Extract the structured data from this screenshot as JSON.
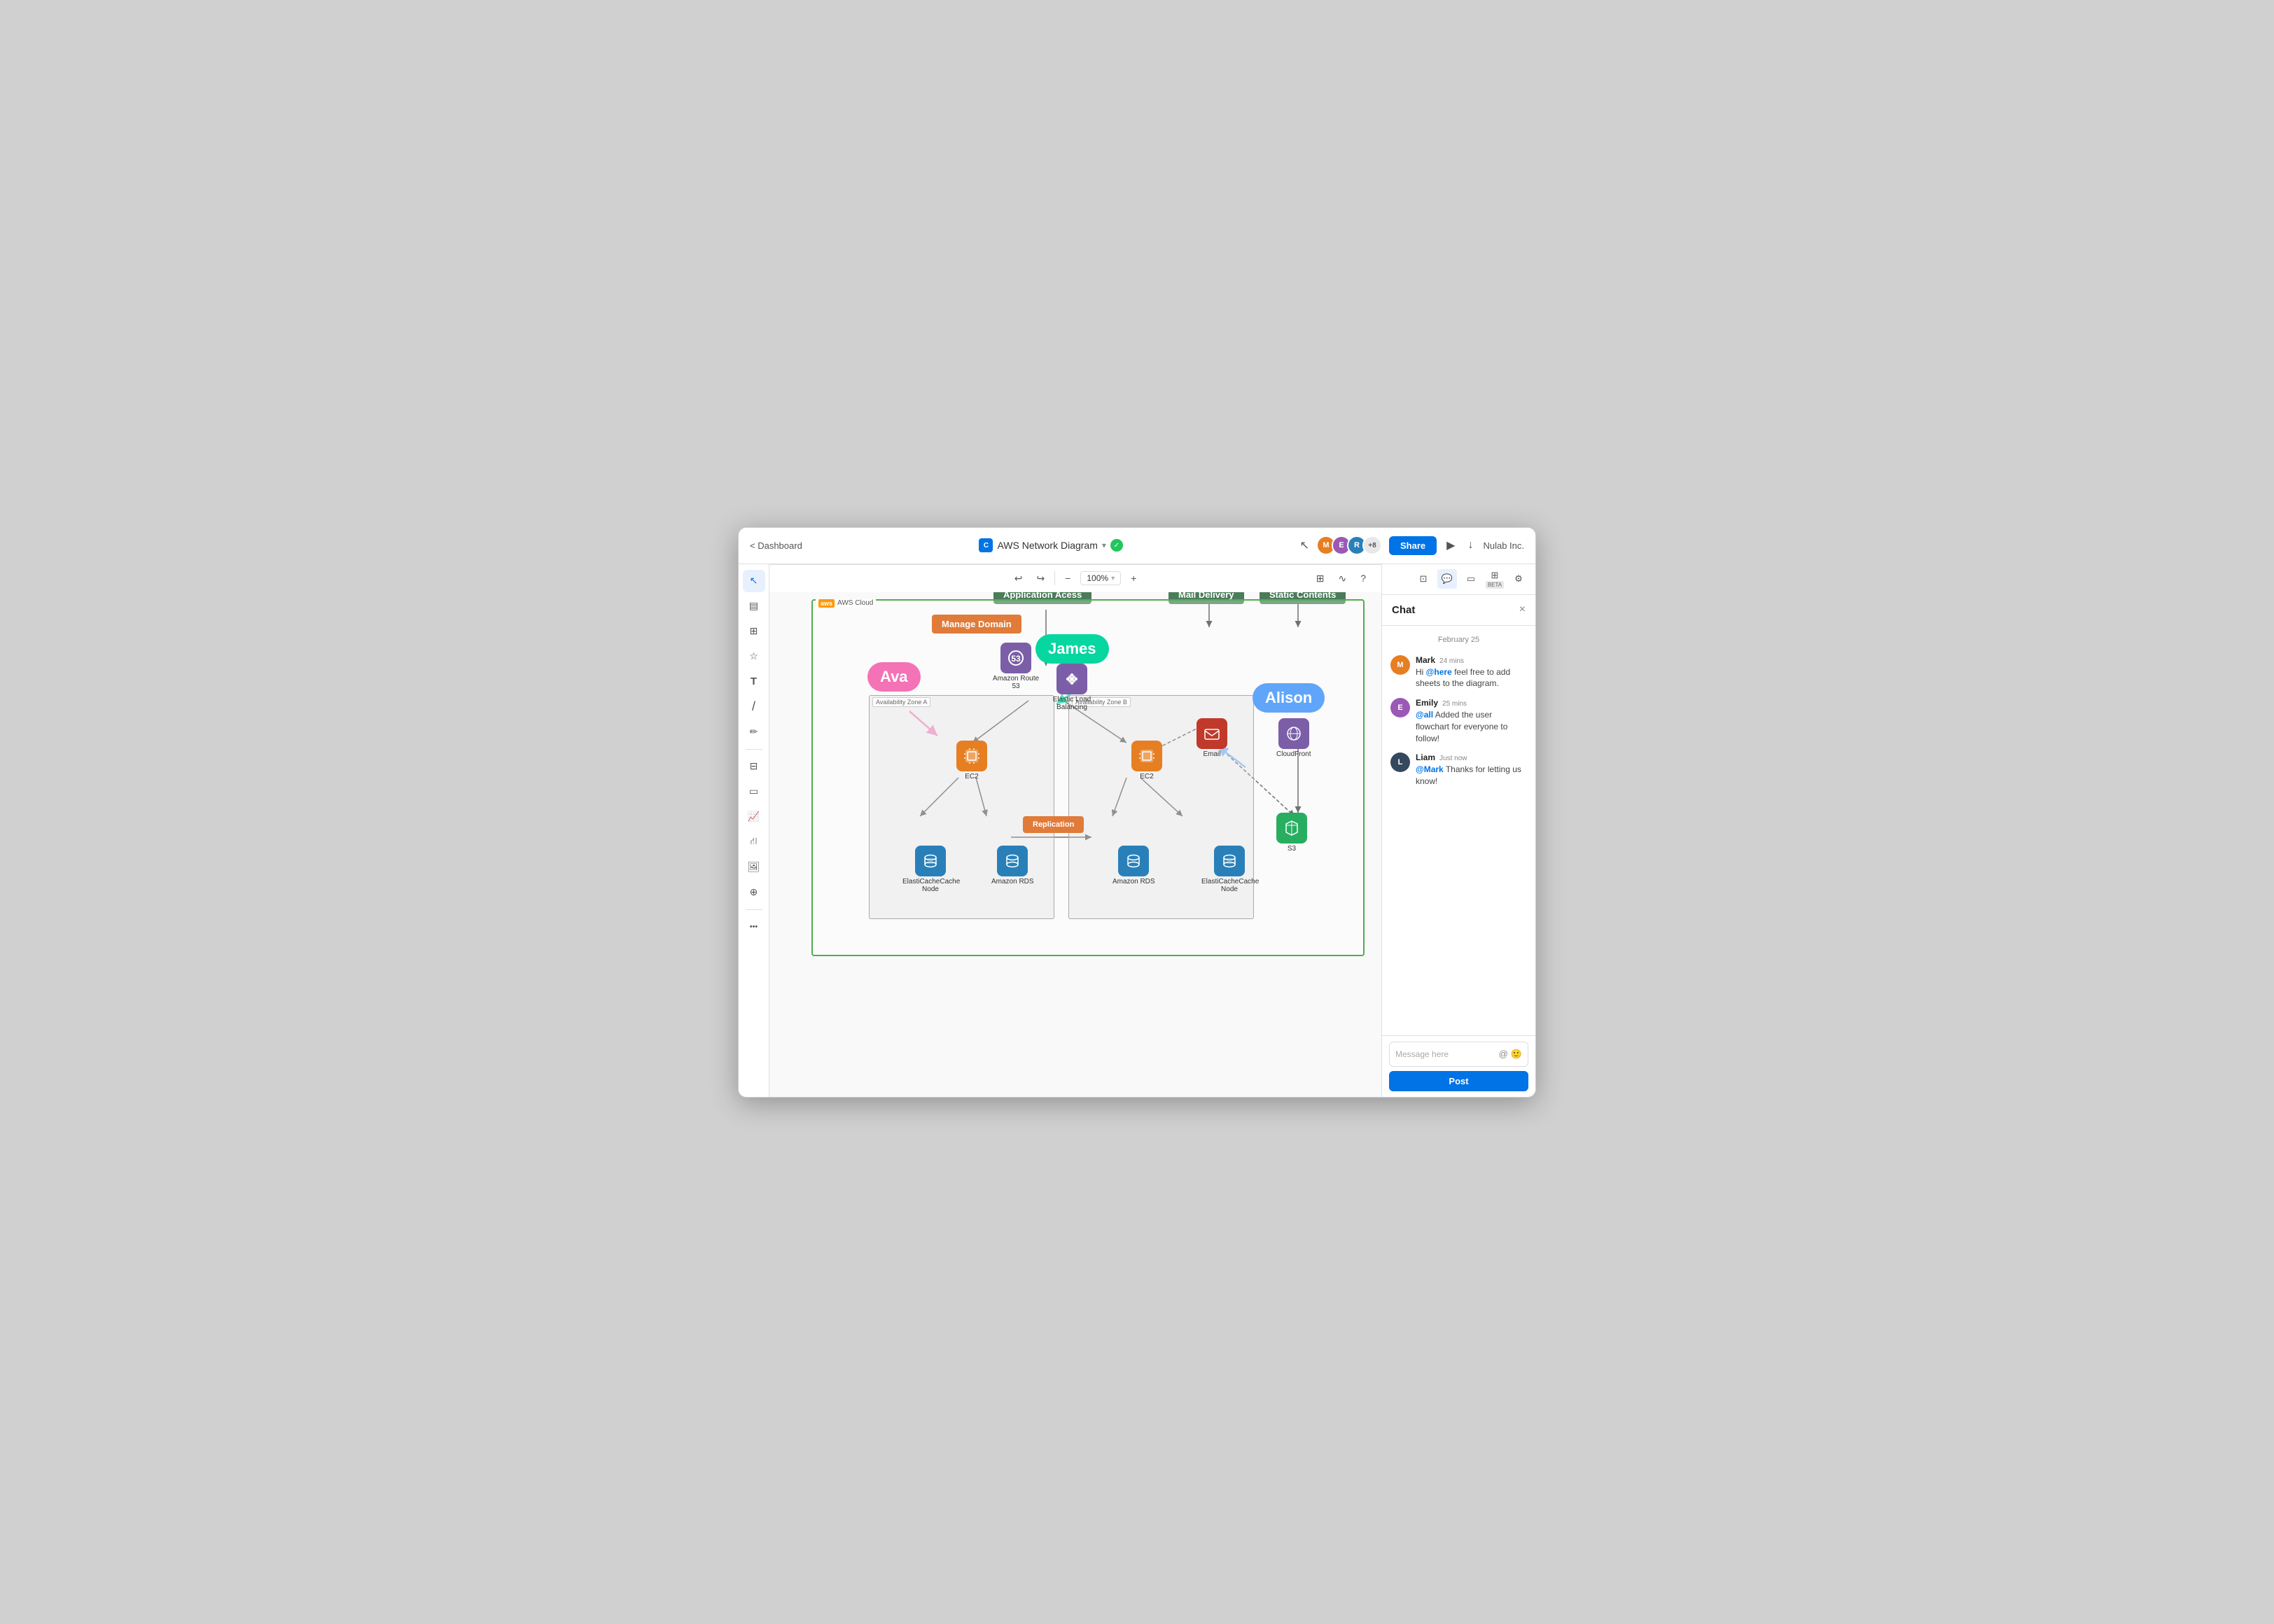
{
  "window": {
    "title": "AWS Network Diagram"
  },
  "titlebar": {
    "back_label": "< Dashboard",
    "diagram_name": "AWS Network Diagram",
    "check_icon": "✓",
    "share_label": "Share",
    "org_name": "Nulab Inc.",
    "avatar_plus": "+8"
  },
  "toolbar_icons": {
    "play": "▶",
    "download": "↓",
    "settings": "⚙"
  },
  "left_tools": [
    {
      "name": "cursor",
      "icon": "↖",
      "active": true
    },
    {
      "name": "notes",
      "icon": "▤"
    },
    {
      "name": "shapes",
      "icon": "⊞"
    },
    {
      "name": "favorites",
      "icon": "☆"
    },
    {
      "name": "text",
      "icon": "T"
    },
    {
      "name": "line",
      "icon": "/"
    },
    {
      "name": "pen",
      "icon": "✏"
    },
    {
      "name": "table",
      "icon": "⊟"
    },
    {
      "name": "card",
      "icon": "▭"
    },
    {
      "name": "chart",
      "icon": "📈"
    },
    {
      "name": "network",
      "icon": "⛙"
    },
    {
      "name": "image",
      "icon": "🖼"
    },
    {
      "name": "embed",
      "icon": "⊕"
    },
    {
      "name": "more",
      "icon": "..."
    }
  ],
  "diagram": {
    "aws_cloud_label": "AWS Cloud",
    "aws_badge": "aws",
    "nodes": {
      "route53": {
        "label": "Amazon Route 53"
      },
      "elb": {
        "label": "Elastic Load Balancing"
      },
      "ec2_a": {
        "label": "EC2"
      },
      "ec2_b": {
        "label": "EC2"
      },
      "elasticache_a": {
        "label": "ElastiCacheCache Node"
      },
      "rds_a": {
        "label": "Amazon RDS"
      },
      "rds_b": {
        "label": "Amazon RDS"
      },
      "elasticache_b": {
        "label": "ElastiCacheCache Node"
      },
      "email": {
        "label": "Email"
      },
      "cloudfront": {
        "label": "CloudFront"
      },
      "s3": {
        "label": "S3"
      }
    },
    "labels": {
      "app_access": "Application Acess",
      "mail_delivery": "Mail Delivery",
      "static_contents": "Static Contents",
      "manage_domain": "Manage Domain",
      "replication": "Replication",
      "az_a": "Availability Zone A",
      "az_b": "Availability Zone B"
    },
    "cursors": [
      {
        "name": "Ava",
        "color": "#f472b6"
      },
      {
        "name": "James",
        "color": "#06d6a0"
      },
      {
        "name": "Alison",
        "color": "#60a5fa"
      }
    ]
  },
  "right_panel": {
    "tools": [
      {
        "name": "screen",
        "icon": "⊡"
      },
      {
        "name": "chat",
        "icon": "💬",
        "active": true
      },
      {
        "name": "video",
        "icon": "▭"
      },
      {
        "name": "beta_collab",
        "icon": "⊞",
        "beta": true
      },
      {
        "name": "settings",
        "icon": "⚙"
      }
    ]
  },
  "chat": {
    "title": "Chat",
    "close_icon": "×",
    "date_divider": "February 25",
    "messages": [
      {
        "author": "Mark",
        "time": "24 mins",
        "avatar_color": "#e67e22",
        "text": "Hi @here feel free to add sheets to the diagram.",
        "mention": "@here"
      },
      {
        "author": "Emily",
        "time": "25 mins",
        "avatar_color": "#9b59b6",
        "text": "@all Added the user flowchart for everyone to follow!",
        "mention": "@all"
      },
      {
        "author": "Liam",
        "time": "Just now",
        "avatar_color": "#34495e",
        "text": "@Mark Thanks for letting us know!",
        "mention": "@Mark"
      }
    ],
    "input_placeholder": "Message here",
    "post_label": "Post"
  },
  "bottom_toolbar": {
    "undo": "↩",
    "redo": "↪",
    "zoom_out": "−",
    "zoom_level": "100%",
    "zoom_in": "+",
    "fit": "⊞",
    "wave": "∿",
    "help": "?"
  }
}
